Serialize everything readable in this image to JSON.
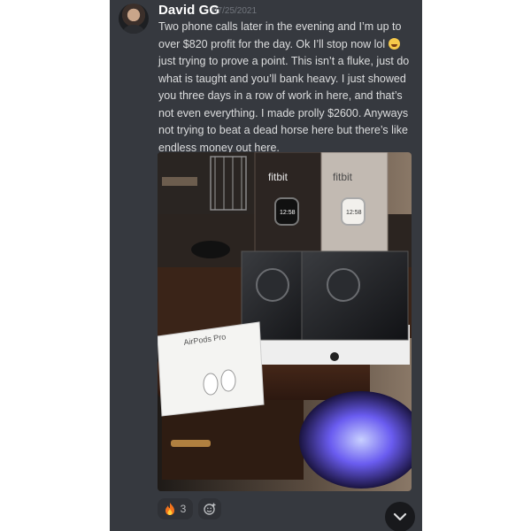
{
  "message": {
    "author": "David GG",
    "timestamp": "07/25/2021",
    "text_part1": "Two phone calls later in the evening and I’m up to over $820 profit for the day. Ok I’ll stop now lol",
    "emoji_icon": "laughing-face-emoji",
    "text_part2": "just trying to prove a point. This isn’t a fluke, just do what is taught and you’ll bank heavy. I just showed you three days in a row of work in here, and that’s not even everything. I made prolly $2600.  Anyways not trying to beat a dead horse here but there’s like endless money out here."
  },
  "attachment": {
    "fitbit_box_1_label": "fitbit",
    "fitbit_box_2_label": "fitbit",
    "watch_1_time": "12:58",
    "watch_2_time": "12:58",
    "airpods_box_label": "AirPods Pro"
  },
  "reactions": {
    "fire_icon": "fire-emoji",
    "fire_count": "3",
    "add_reaction_icon": "add-reaction-smile-icon"
  },
  "jump_icon": "chevron-down-icon",
  "colors": {
    "panel_background": "#36393f",
    "author_color": "#ffffff",
    "text_color": "#dcddde",
    "timestamp_color": "#72767d"
  }
}
